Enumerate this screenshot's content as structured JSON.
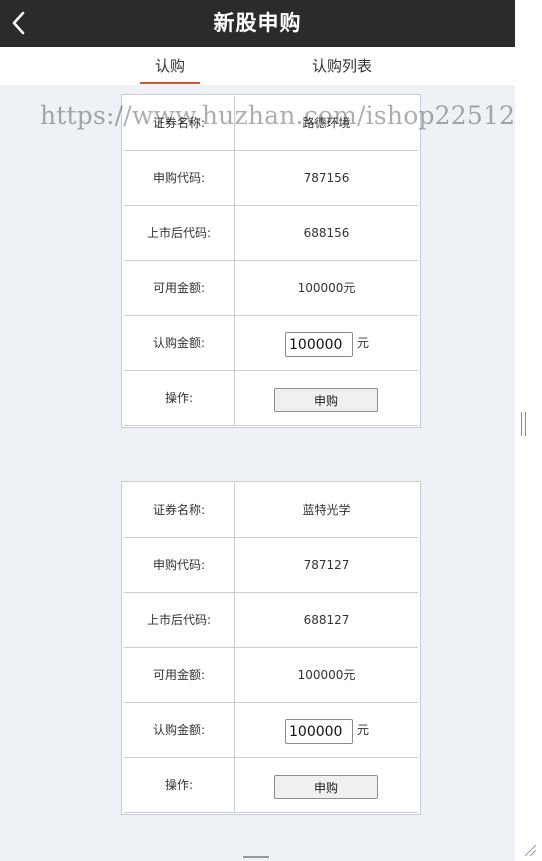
{
  "header": {
    "title": "新股申购",
    "back_icon": "chevron-left-icon"
  },
  "tabs": [
    {
      "label": "认购",
      "active": true
    },
    {
      "label": "认购列表",
      "active": false
    }
  ],
  "watermark": "https://www.huzhan.com/ishop22512",
  "colors": {
    "header_bg": "#2b2b2b",
    "tab_active_underline": "#e0522a",
    "page_bg": "#eef1f5"
  },
  "cards": [
    {
      "name_label": "证券名称:",
      "name_value": "路德环境",
      "code_label": "申购代码:",
      "code_value": "787156",
      "listed_code_label": "上市后代码:",
      "listed_code_value": "688156",
      "available_label": "可用金额:",
      "available_value": "100000元",
      "amount_label": "认购金额:",
      "amount_input_value": "100000",
      "amount_unit": "元",
      "action_label": "操作:",
      "action_button": "申购"
    },
    {
      "name_label": "证券名称:",
      "name_value": "蓝特光学",
      "code_label": "申购代码:",
      "code_value": "787127",
      "listed_code_label": "上市后代码:",
      "listed_code_value": "688127",
      "available_label": "可用金额:",
      "available_value": "100000元",
      "amount_label": "认购金额:",
      "amount_input_value": "100000",
      "amount_unit": "元",
      "action_label": "操作:",
      "action_button": "申购"
    }
  ]
}
